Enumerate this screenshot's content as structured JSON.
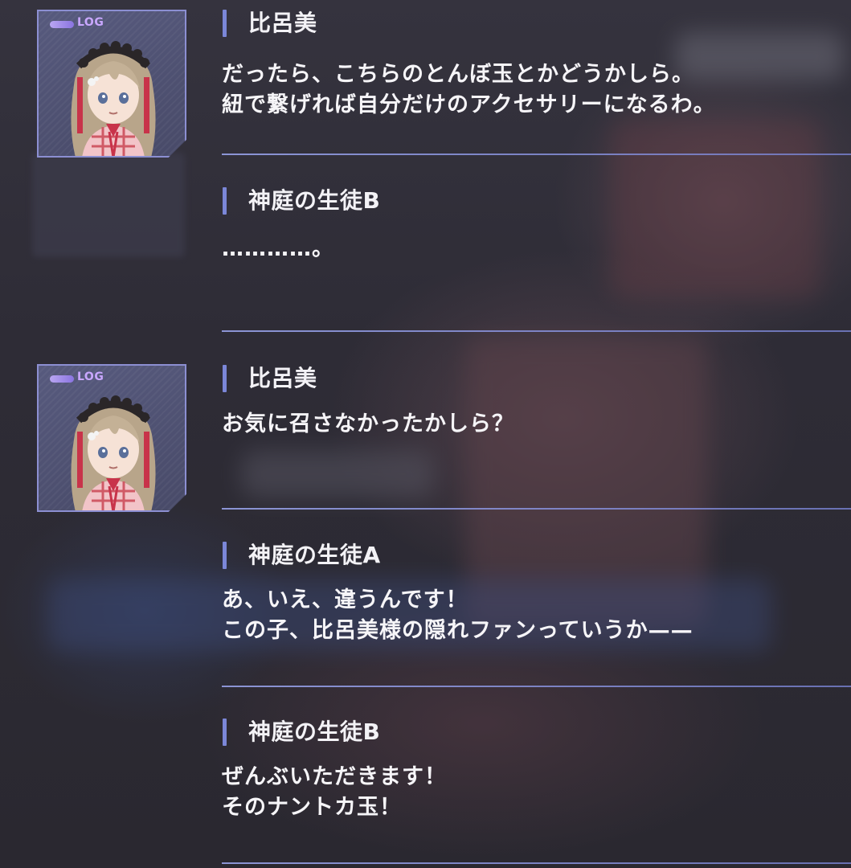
{
  "portrait": {
    "badge_label": "LOG",
    "character_icon": "himemi-portrait"
  },
  "entries": [
    {
      "speaker": "比呂美",
      "lines": [
        "だったら、こちらのとんぼ玉とかどうかしら。",
        "紐で繋げれば自分だけのアクセサリーになるわ。"
      ],
      "has_portrait": true
    },
    {
      "speaker": "神庭の生徒B",
      "lines": [
        "…………。"
      ],
      "has_portrait": false
    },
    {
      "speaker": "比呂美",
      "lines": [
        "お気に召さなかったかしら？"
      ],
      "has_portrait": true
    },
    {
      "speaker": "神庭の生徒A",
      "lines": [
        "あ、いえ、違うんです！",
        "この子、比呂美様の隠れファンっていうか——"
      ],
      "has_portrait": false
    },
    {
      "speaker": "神庭の生徒B",
      "lines": [
        "ぜんぶいただきます！",
        "そのナントカ玉！"
      ],
      "has_portrait": false
    }
  ],
  "colors": {
    "accent": "#7b87d8",
    "divider": "#8a95e0",
    "text": "#f6f5f8",
    "log_badge": "#c9a7ff"
  }
}
